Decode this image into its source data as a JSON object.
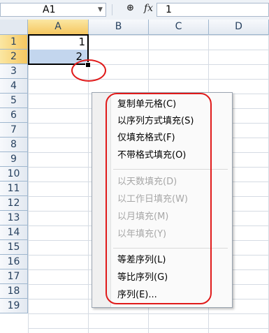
{
  "formula_bar": {
    "name_box": "A1",
    "fx_label": "fx",
    "value": "1"
  },
  "columns": [
    "A",
    "B",
    "C",
    "D"
  ],
  "rows": [
    "1",
    "2",
    "3",
    "4",
    "5",
    "6",
    "7",
    "8",
    "9",
    "10",
    "11",
    "12",
    "13",
    "14",
    "15",
    "16",
    "17",
    "18",
    "19"
  ],
  "cells": {
    "A1": "1",
    "A2": "2"
  },
  "context_menu": {
    "items": [
      {
        "label": "复制单元格(C)",
        "enabled": true
      },
      {
        "label": "以序列方式填充(S)",
        "enabled": true
      },
      {
        "label": "仅填充格式(F)",
        "enabled": true
      },
      {
        "label": "不带格式填充(O)",
        "enabled": true
      },
      {
        "label": "以天数填充(D)",
        "enabled": false
      },
      {
        "label": "以工作日填充(W)",
        "enabled": false
      },
      {
        "label": "以月填充(M)",
        "enabled": false
      },
      {
        "label": "以年填充(Y)",
        "enabled": false
      },
      {
        "label": "等差序列(L)",
        "enabled": true
      },
      {
        "label": "等比序列(G)",
        "enabled": true
      },
      {
        "label": "序列(E)...",
        "enabled": true
      }
    ]
  },
  "colors": {
    "highlight": "#e01a1a",
    "selected_header": "#f5c760",
    "selection_fill": "#c3d6ee"
  }
}
